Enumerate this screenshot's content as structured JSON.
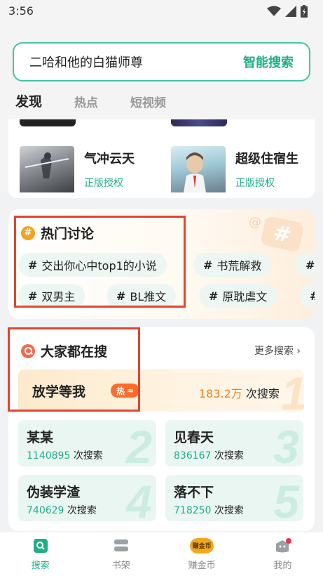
{
  "status_bar": {
    "time": "3:56"
  },
  "search": {
    "query": "二哈和他的白猫师尊",
    "button_label": "智能搜索"
  },
  "tabs": [
    {
      "label": "发现",
      "active": true
    },
    {
      "label": "热点",
      "active": false
    },
    {
      "label": "短视频",
      "active": false
    }
  ],
  "books": [
    {
      "title": "气冲云天",
      "tag": "正版授权"
    },
    {
      "title": "超级住宿生",
      "tag": "正版授权"
    }
  ],
  "hot_discussion": {
    "title": "热门讨论",
    "row1": [
      "交出你心中top1的小说",
      "书荒解救"
    ],
    "row2": [
      "双男主",
      "BL推文",
      "原耽虐文"
    ]
  },
  "everyone_searching": {
    "title": "大家都在搜",
    "more_label": "更多搜索",
    "top": {
      "name": "放学等我",
      "badge": "热",
      "count": "183.2万",
      "unit": "次搜索",
      "rank": "1"
    },
    "items": [
      {
        "name": "某某",
        "count": "1140895",
        "unit": "次搜索",
        "rank": "2"
      },
      {
        "name": "见春天",
        "count": "836167",
        "unit": "次搜索",
        "rank": "3"
      },
      {
        "name": "伪装学渣",
        "count": "740629",
        "unit": "次搜索",
        "rank": "4"
      },
      {
        "name": "落不下",
        "count": "718250",
        "unit": "次搜索",
        "rank": "5"
      }
    ]
  },
  "bottom_nav": [
    {
      "label": "搜索",
      "active": true
    },
    {
      "label": "书架",
      "active": false
    },
    {
      "label": "赚金币",
      "active": false,
      "icon_text": "赚金币"
    },
    {
      "label": "我的",
      "active": false
    }
  ],
  "colors": {
    "accent": "#1fae89",
    "highlight": "#e2452f",
    "hot_orange": "#ef7e1a"
  }
}
